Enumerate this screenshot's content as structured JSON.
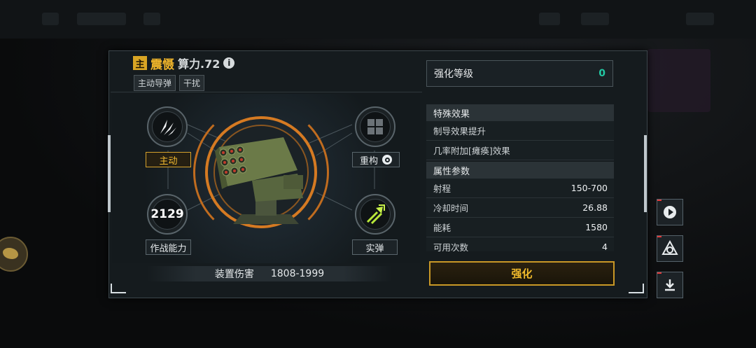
{
  "weapon": {
    "main_badge": "主",
    "name": "震慑",
    "power": "算力.72",
    "tags": [
      "主动导弹",
      "干扰"
    ]
  },
  "slots": {
    "active": "主动",
    "reform": "重构",
    "combat_value": "2129",
    "combat_label": "作战能力",
    "ammo": "实弹"
  },
  "damage": {
    "label": "装置伤害",
    "value": "1808-1999"
  },
  "level": {
    "label": "强化等级",
    "value": "0"
  },
  "special": {
    "title": "特殊效果",
    "items": [
      "制导效果提升",
      "几率附加[瘫痪]效果"
    ]
  },
  "attributes": {
    "title": "属性参数",
    "rows": [
      {
        "name": "射程",
        "value": "150-700"
      },
      {
        "name": "冷却时间",
        "value": "26.88"
      },
      {
        "name": "能耗",
        "value": "1580"
      },
      {
        "name": "可用次数",
        "value": "4"
      }
    ]
  },
  "enhance_button": "强化",
  "colors": {
    "accent_gold": "#f0b52a",
    "accent_orange": "#d57a22",
    "level_teal": "#22c9a4"
  }
}
